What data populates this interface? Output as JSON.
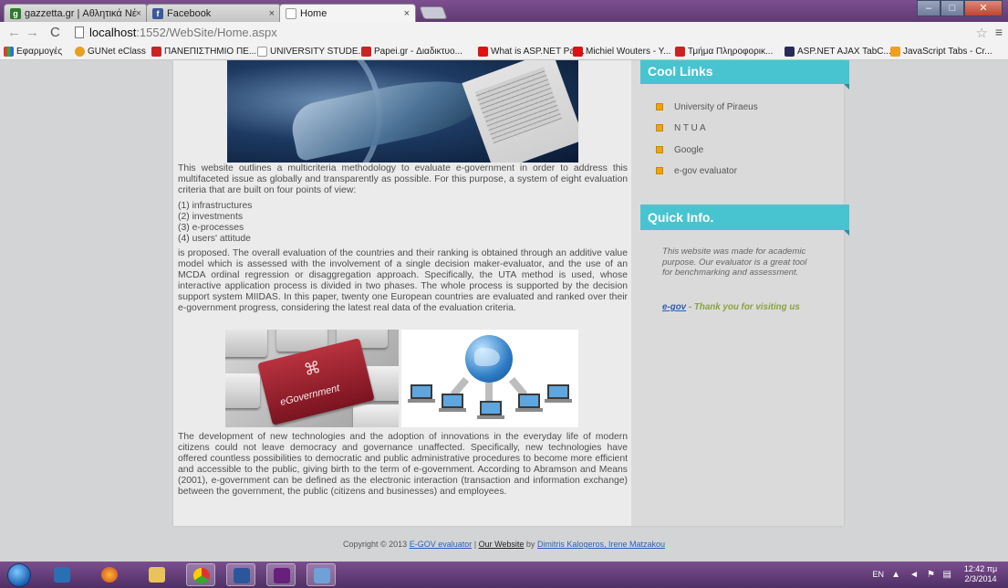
{
  "browser": {
    "tabs": [
      {
        "label": "gazzetta.gr | Αθλητικά Νέ",
        "favicon": "gazzetta-favicon"
      },
      {
        "label": "Facebook",
        "favicon": "facebook-favicon"
      },
      {
        "label": "Home",
        "favicon": "page-favicon"
      }
    ],
    "url_host": "localhost",
    "url_path": ":1552/WebSite/Home.aspx",
    "bookmarks": [
      "Εφαρμογές",
      "GUNet eClass",
      "ΠΑΝΕΠΙΣΤΗΜΙΟ ΠΕ...",
      "UNIVERSITY STUDE...",
      "Papei.gr - Διαδικτυο...",
      "What is ASP.NET Par...",
      "Michiel Wouters - Y...",
      "Τμήμα Πληροφορικ...",
      "ASP.NET AJAX TabC...",
      "JavaScript Tabs - Cr..."
    ]
  },
  "main": {
    "intro": "This website outlines a multicriteria methodology to evaluate e-government in order to address this multifaceted issue as globally and transparently as possible. For this purpose, a system of eight evaluation criteria that are built on four points of view:",
    "points": [
      "(1) infrastructures",
      "(2) investments",
      "(3) e-processes",
      "(4) users' attitude"
    ],
    "proposed": "is proposed. The overall evaluation of the countries and their ranking is obtained through an additive value model which is assessed with the involvement of a single decision maker-evaluator, and the use of an MCDA ordinal regression or disaggregation approach. Specifically, the UTA method is used, whose interactive application process is divided in two phases. The whole process is supported by the decision support system MIIDAS. In this paper, twenty one European countries are evaluated and ranked over their e-government progress, considering the latest real data of the evaluation criteria.",
    "keyboard_text": "eGovernment",
    "development": "The development of new technologies and the adoption of innovations in the everyday life of modern citizens could not leave democracy and governance unaffected. Specifically, new technologies have offered countless possibilities to democratic and public administrative procedures to become more efficient and accessible to the public, giving birth to the term of e-government. According to Abramson and Means (2001), e-government can be defined as the electronic interaction (transaction and information exchange) between the government, the public (citizens and businesses) and employees."
  },
  "sidebar": {
    "cool_links_title": "Cool Links",
    "links": [
      "University of Piraeus",
      "N T U A",
      "Google",
      "e-gov evaluator"
    ],
    "quick_info_title": "Quick Info.",
    "quick_info_text": "This website was made for academic purpose. Our evaluator is a great tool for benchmarking and assessment.",
    "egov_link": "e-gov",
    "thanks": " - Thank you for visiting us"
  },
  "footer": {
    "copyright": "Copyright © 2013 ",
    "egov_evaluator": "E-GOV evaluator",
    "sep": " | ",
    "our_website": "Our Website",
    "by": " by ",
    "authors": "Dimitris Kalogeros, Irene Matzakou"
  },
  "taskbar": {
    "lang": "EN",
    "time": "12:42 πμ",
    "date": "2/3/2014"
  }
}
